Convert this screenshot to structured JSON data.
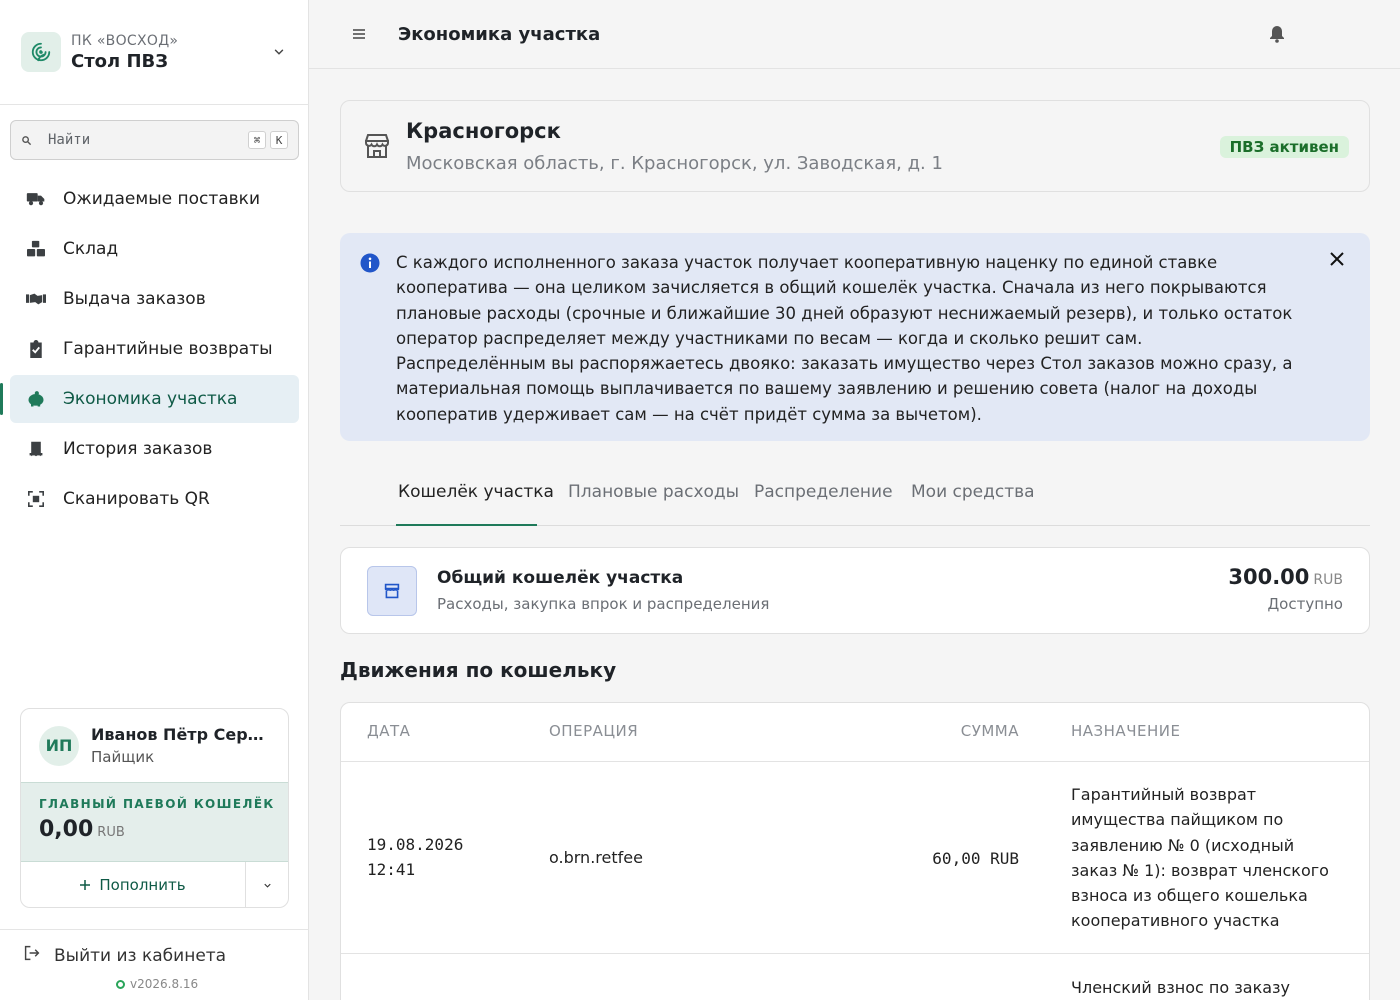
{
  "sidebar": {
    "org_sub": "ПК «ВОСХОД»",
    "org_name": "Стол ПВЗ",
    "search_placeholder": "Найти",
    "kbd": [
      "⌘",
      "K"
    ],
    "items": [
      {
        "label": "Ожидаемые поставки",
        "icon": "truck-icon"
      },
      {
        "label": "Склад",
        "icon": "boxes-icon"
      },
      {
        "label": "Выдача заказов",
        "icon": "handshake-icon"
      },
      {
        "label": "Гарантийные возвраты",
        "icon": "clipboard-check-icon"
      },
      {
        "label": "Экономика участка",
        "icon": "piggy-bank-icon",
        "active": true
      },
      {
        "label": "История заказов",
        "icon": "receipt-icon"
      },
      {
        "label": "Сканировать QR",
        "icon": "qr-code-icon"
      }
    ],
    "user": {
      "initials": "ИП",
      "name": "Иванов Пётр Сергеевич",
      "role": "Пайщик",
      "wallet_label": "ГЛАВНЫЙ ПАЕВОЙ КОШЕЛЁК",
      "wallet_amount": "0,00",
      "wallet_currency": "RUB",
      "topup_label": "Пополнить"
    },
    "logout_label": "Выйти из кабинета",
    "version": "v2026.8.16"
  },
  "header": {
    "title": "Экономика участка"
  },
  "location": {
    "city": "Красногорск",
    "address": "Московская область, г. Красногорск, ул. Заводская, д. 1",
    "status": "ПВЗ активен"
  },
  "info": {
    "text": "С каждого исполненного заказа участок получает кооперативную наценку по единой ставке кооператива — она целиком зачисляется в общий кошелёк участка. Сначала из него покрываются плановые расходы (срочные и ближайшие 30 дней образуют неснижаемый резерв), и только остаток оператор распределяет между участниками по весам — когда и сколько решит сам. Распределённым вы распоряжаетесь двояко: заказать имущество через Стол заказов можно сразу, а материальная помощь выплачивается по вашему заявлению и решению совета (налог на доходы кооператив удерживает сам — на счёт придёт сумма за вычетом)."
  },
  "tabs": [
    "Кошелёк участка",
    "Плановые расходы",
    "Распределение",
    "Мои средства"
  ],
  "wallet_card": {
    "title": "Общий кошелёк участка",
    "subtitle": "Расходы, закупка впрок и распределения",
    "amount": "300.00",
    "currency": "RUB",
    "available": "Доступно"
  },
  "movements": {
    "title": "Движения по кошельку",
    "columns": [
      "ДАТА",
      "ОПЕРАЦИЯ",
      "СУММА",
      "НАЗНАЧЕНИЕ"
    ],
    "rows": [
      {
        "date": "19.08.2026",
        "time": "12:41",
        "operation": "o.brn.retfee",
        "amount": "60,00 RUB",
        "purpose": "Гарантийный возврат имущества пайщиком по заявлению № 0 (исходный заказ № 1): возврат членского взноса из общего кошелька кооперативного участка"
      },
      {
        "purpose": "Членский взнос по заказу"
      }
    ]
  }
}
